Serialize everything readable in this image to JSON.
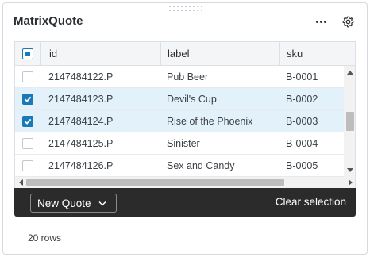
{
  "panel": {
    "title": "MatrixQuote"
  },
  "grid": {
    "columns": [
      {
        "label": "id"
      },
      {
        "label": "label"
      },
      {
        "label": "sku"
      }
    ],
    "rows": [
      {
        "id": "2147484122.P",
        "label": "Pub Beer",
        "sku": "B-0001",
        "selected": false
      },
      {
        "id": "2147484123.P",
        "label": "Devil's Cup",
        "sku": "B-0002",
        "selected": true
      },
      {
        "id": "2147484124.P",
        "label": "Rise of the Phoenix",
        "sku": "B-0003",
        "selected": true
      },
      {
        "id": "2147484125.P",
        "label": "Sinister",
        "sku": "B-0004",
        "selected": false
      },
      {
        "id": "2147484126.P",
        "label": "Sex and Candy",
        "sku": "B-0005",
        "selected": false
      }
    ],
    "header_checkbox_state": "partial"
  },
  "actionbar": {
    "new_quote_label": "New Quote",
    "clear_selection_label": "Clear selection"
  },
  "footer": {
    "row_count": "20 rows"
  },
  "colors": {
    "accent": "#1a7ab7",
    "selected_row": "#e3f1fa",
    "actionbar_bg": "#2b2b2b"
  },
  "icons": {
    "more": "more-horizontal-icon",
    "settings": "gear-icon",
    "dropdown": "chevron-down-icon"
  }
}
